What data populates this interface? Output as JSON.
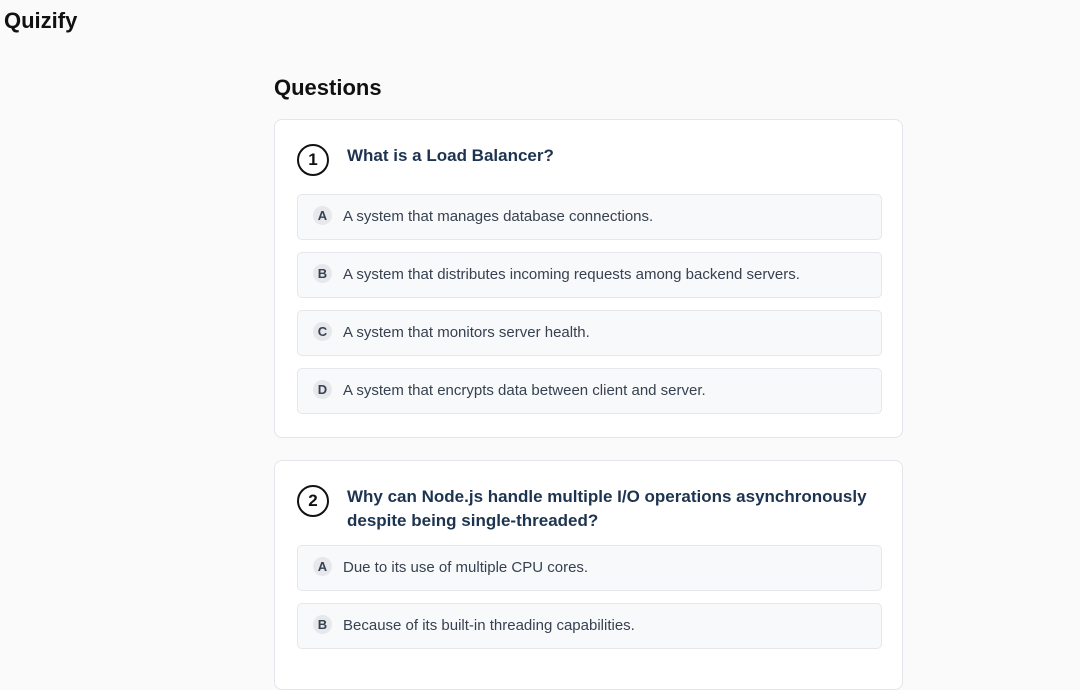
{
  "app": {
    "title": "Quizify"
  },
  "main": {
    "heading": "Questions",
    "questions": [
      {
        "number": "1",
        "text": "What is a Load Balancer?",
        "options": [
          {
            "letter": "A",
            "text": "A system that manages database connections."
          },
          {
            "letter": "B",
            "text": "A system that distributes incoming requests among backend servers."
          },
          {
            "letter": "C",
            "text": "A system that monitors server health."
          },
          {
            "letter": "D",
            "text": "A system that encrypts data between client and server."
          }
        ]
      },
      {
        "number": "2",
        "text": "Why can Node.js handle multiple I/O operations asynchronously despite being single-threaded?",
        "options": [
          {
            "letter": "A",
            "text": "Due to its use of multiple CPU cores."
          },
          {
            "letter": "B",
            "text": "Because of its built-in threading capabilities."
          }
        ]
      }
    ]
  }
}
